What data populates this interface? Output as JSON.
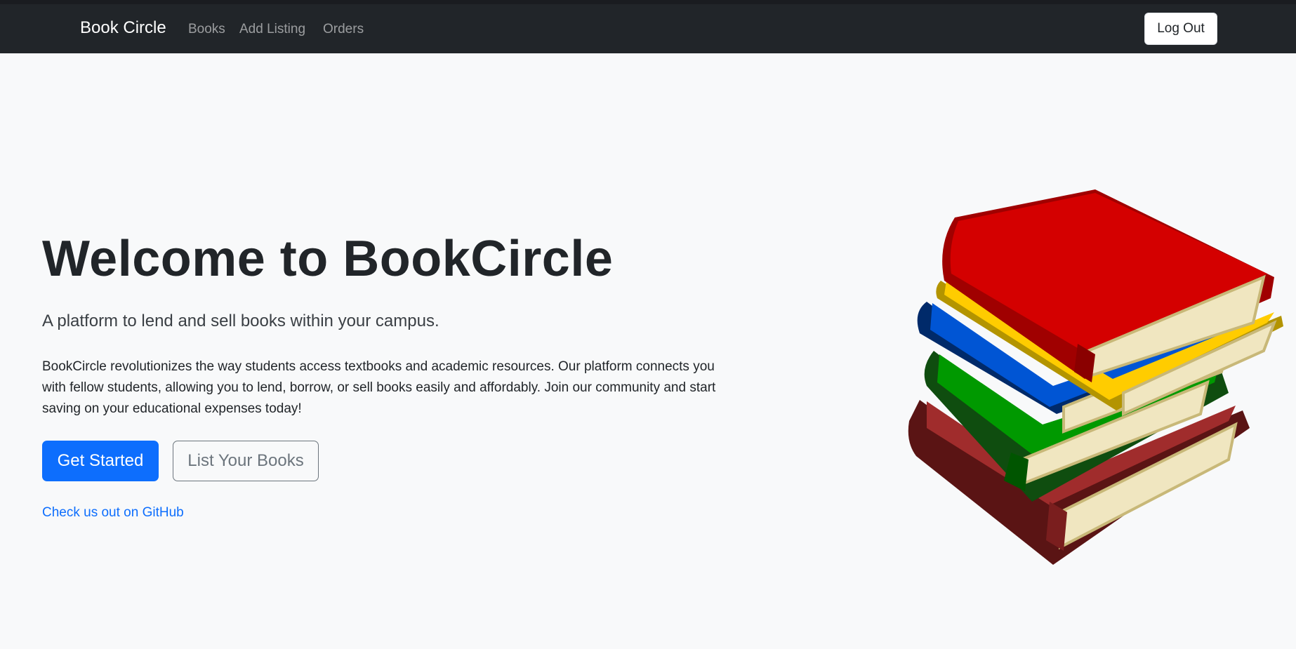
{
  "navbar": {
    "brand": "Book Circle",
    "links": [
      "Books",
      "Add Listing",
      "Orders"
    ],
    "logout_label": "Log Out"
  },
  "hero": {
    "title": "Welcome to BookCircle",
    "lead": "A platform to lend and sell books within your campus.",
    "description": "BookCircle revolutionizes the way students access textbooks and academic resources. Our platform connects you with fellow students, allowing you to lend, borrow, or sell books easily and affordably. Join our community and start saving on your educational expenses today!",
    "primary_button": "Get Started",
    "secondary_button": "List Your Books",
    "github_link": "Check us out on GitHub"
  },
  "illustration": {
    "icon": "stack-of-books-icon",
    "colors": [
      "#d40000",
      "#ffcc00",
      "#0055d4",
      "#009900",
      "#a02c2c"
    ]
  }
}
